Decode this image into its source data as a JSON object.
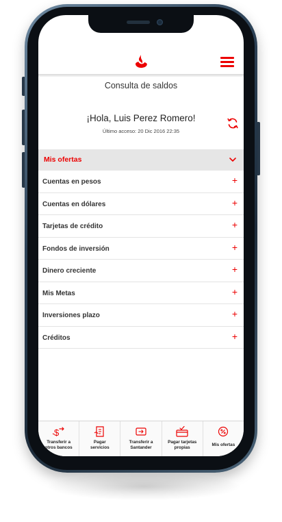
{
  "colors": {
    "brand": "#ec0000",
    "divider": "#e3e3e3",
    "offers_bg": "#e6e6e6"
  },
  "header": {
    "logo_icon": "santander-flame-icon",
    "menu_icon": "hamburger-menu-icon"
  },
  "page": {
    "title": "Consulta de saldos"
  },
  "greeting": {
    "text": "¡Hola, Luis Perez Romero!",
    "last_access": "Último acceso: 20 Dic 2016 22:35",
    "refresh_icon": "refresh-icon"
  },
  "offers": {
    "label": "Mis ofertas",
    "icon": "chevron-down-icon"
  },
  "accounts": {
    "items": [
      {
        "label": "Cuentas en pesos",
        "icon": "plus-icon",
        "symbol": "+"
      },
      {
        "label": "Cuentas en dólares",
        "icon": "plus-icon",
        "symbol": "+"
      },
      {
        "label": "Tarjetas de crédito",
        "icon": "plus-icon",
        "symbol": "+"
      },
      {
        "label": "Fondos de inversión",
        "icon": "plus-icon",
        "symbol": "+"
      },
      {
        "label": "Dinero creciente",
        "icon": "plus-icon",
        "symbol": "+"
      },
      {
        "label": "Mis Metas",
        "icon": "plus-icon",
        "symbol": "+"
      },
      {
        "label": "Inversiones plazo",
        "icon": "plus-icon",
        "symbol": "+"
      },
      {
        "label": "Créditos",
        "icon": "plus-icon",
        "symbol": "+"
      }
    ]
  },
  "bottom_nav": {
    "items": [
      {
        "line1": "Transferir a",
        "line2": "otros bancos",
        "icon": "transfer-money-icon"
      },
      {
        "line1": "Pagar",
        "line2": "servicios",
        "icon": "pay-bill-icon"
      },
      {
        "line1": "Transferir a",
        "line2": "Santander",
        "icon": "transfer-santander-icon"
      },
      {
        "line1": "Pagar tarjetas",
        "line2": "propias",
        "icon": "pay-card-icon"
      },
      {
        "line1": "Mis ofertas",
        "line2": "",
        "icon": "offers-badge-icon"
      }
    ]
  }
}
